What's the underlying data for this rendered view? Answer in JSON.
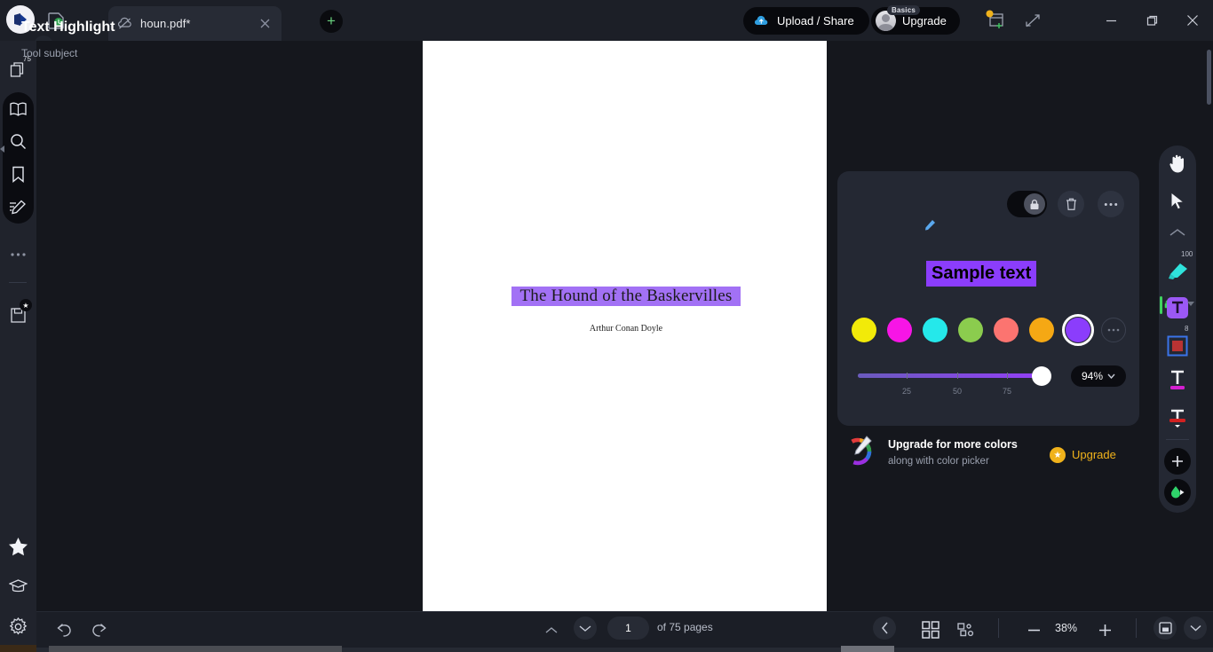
{
  "app": {
    "tab": {
      "name": "houn.pdf*",
      "cloud_icon": "cloud-off-icon",
      "close_icon": "close-icon"
    },
    "new_tab_label": "+",
    "cloud_tab_icon": "cloud-sync-icon",
    "logo_icon": "app-logo-icon"
  },
  "titlebar": {
    "upload_share_label": "Upload / Share",
    "upgrade_label": "Upgrade",
    "plan_badge": "Basics",
    "add_window_icon": "add-window-icon",
    "expand_icon": "expand-diagonal-icon",
    "minimize_icon": "minimize-icon",
    "maximize_icon": "restore-icon",
    "close_icon": "window-close-icon"
  },
  "left_rail": {
    "pages_badge": "75",
    "items": [
      {
        "name": "pages-thumbnails",
        "icon": "copy-pages-icon"
      },
      {
        "name": "read-mode",
        "icon": "book-open-icon"
      },
      {
        "name": "search",
        "icon": "search-icon"
      },
      {
        "name": "bookmarks",
        "icon": "bookmark-icon"
      },
      {
        "name": "annotations",
        "icon": "annotate-pen-icon"
      },
      {
        "name": "more",
        "icon": "more-horizontal-icon"
      },
      {
        "name": "save-export",
        "icon": "save-file-icon"
      },
      {
        "name": "favorites",
        "icon": "star-icon"
      },
      {
        "name": "learn",
        "icon": "graduation-cap-icon"
      },
      {
        "name": "settings",
        "icon": "gear-icon"
      }
    ]
  },
  "document": {
    "title": "The Hound of the Baskervilles",
    "author": "Arthur Conan Doyle",
    "highlight_color": "#8b3dfc"
  },
  "panel": {
    "title": "Text Highlight",
    "subtitle": "Tool subject",
    "edit_icon": "pencil-icon",
    "lock_toggle_icon": "lock-icon",
    "delete_icon": "trash-icon",
    "more_icon": "more-horizontal-icon",
    "sample_text": "Sample text",
    "swatches": [
      {
        "name": "yellow",
        "hex": "#f2ea09"
      },
      {
        "name": "magenta",
        "hex": "#f715e6"
      },
      {
        "name": "cyan",
        "hex": "#25e8ea"
      },
      {
        "name": "green",
        "hex": "#8bcc4e"
      },
      {
        "name": "salmon",
        "hex": "#fc7470"
      },
      {
        "name": "orange",
        "hex": "#f5a814"
      },
      {
        "name": "purple",
        "hex": "#8b3dfc"
      }
    ],
    "selected_swatch_index": 6,
    "more_colors_icon": "more-horizontal-icon",
    "opacity": {
      "value": "94%",
      "percent": 94,
      "ticks": [
        "25",
        "50",
        "75"
      ],
      "caret_icon": "chevron-down-icon"
    }
  },
  "promo": {
    "icon": "color-picker-icon",
    "title": "Upgrade for more colors",
    "subtitle": "along with color picker",
    "star_icon": "star-icon",
    "cta": "Upgrade"
  },
  "right_rail": {
    "tools": [
      {
        "name": "pan-hand-tool",
        "icon": "hand-icon"
      },
      {
        "name": "select-tool",
        "icon": "cursor-arrow-icon"
      },
      {
        "name": "collapse-tools",
        "icon": "chevron-up-icon"
      },
      {
        "name": "highlighter-tool",
        "icon": "highlighter-icon",
        "badge": "100"
      },
      {
        "name": "text-highlight-tool",
        "icon": "text-highlight-icon"
      },
      {
        "name": "shape-tool",
        "icon": "square-shape-icon",
        "badge": "8"
      },
      {
        "name": "text-underline-tool",
        "icon": "text-underline-icon"
      },
      {
        "name": "text-strikeout-tool",
        "icon": "text-strikeout-icon"
      },
      {
        "name": "add-tool",
        "icon": "plus-icon"
      },
      {
        "name": "ink-tool",
        "icon": "ink-drop-icon"
      }
    ],
    "lock_icon": "lock-small-icon",
    "dropdown_icon": "chevron-down-icon"
  },
  "bottom_bar": {
    "undo_icon": "undo-icon",
    "redo_icon": "redo-icon",
    "prev_page_icon": "chevron-up-icon",
    "next_page_icon": "chevron-down-icon",
    "page_number": "1",
    "page_total_label": "of 75 pages",
    "back_icon": "chevron-left-icon",
    "grid_view_icon": "grid-view-icon",
    "layout_view_icon": "layout-view-icon",
    "zoom_out_icon": "minus-icon",
    "zoom_level": "38%",
    "zoom_in_icon": "plus-icon",
    "fit_page_icon": "fit-page-icon",
    "view_options_icon": "chevron-down-icon"
  }
}
